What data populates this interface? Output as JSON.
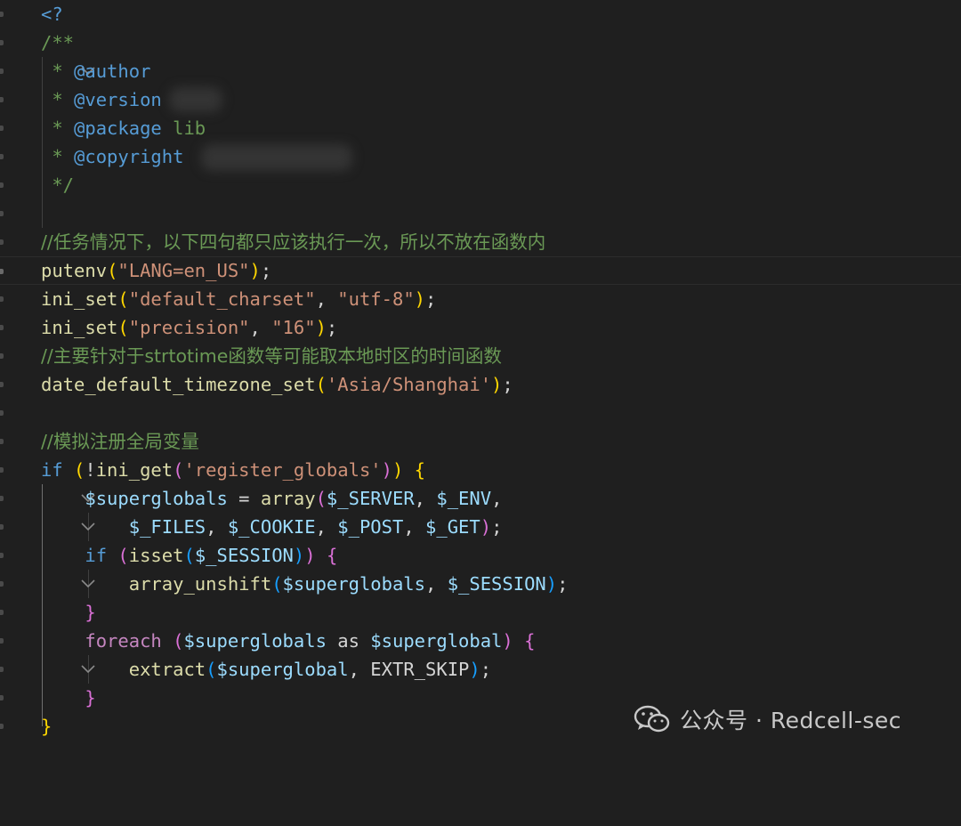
{
  "colors": {
    "background": "#1f1f1f",
    "comment": "#6a9955",
    "string": "#ce9178",
    "function": "#dcdcaa",
    "variable": "#9cdcfe",
    "keyword": "#569cd6",
    "control": "#c586c0",
    "bracket_gold": "#ffd700",
    "bracket_orchid": "#da70d6",
    "bracket_blue": "#179fff"
  },
  "code": {
    "php_open": "<?",
    "doc_open": "/**",
    "author_star": " * ",
    "author_tag": "@author",
    "version_star": " * ",
    "version_tag": "@version",
    "package_star": " * ",
    "package_tag": "@package",
    "package_val": " lib",
    "copyright_star": " * ",
    "copyright_tag": "@copyright",
    "doc_close": " */",
    "comment_1": "//任务情况下，以下四句都只应该执行一次，所以不放在函数内",
    "putenv_fn": "putenv",
    "putenv_arg": "\"LANG=en_US\"",
    "iniset_fn": "ini_set",
    "iniset1_arg1": "\"default_charset\"",
    "iniset1_arg2": "\"utf-8\"",
    "iniset2_arg1": "\"precision\"",
    "iniset2_arg2": "\"16\"",
    "comment_2": "//主要针对于strtotime函数等可能取本地时区的时间函数",
    "tz_fn": "date_default_timezone_set",
    "tz_arg": "'Asia/Shanghai'",
    "comment_3": "//模拟注册全局变量",
    "if_kw": "if",
    "ini_get_fn": "ini_get",
    "register_globals": "'register_globals'",
    "superglobals": "$superglobals",
    "array_fn": "array",
    "server": "$_SERVER",
    "env": "$_ENV",
    "files": "$_FILES",
    "cookie": "$_COOKIE",
    "post": "$_POST",
    "get": "$_GET",
    "isset_fn": "isset",
    "session": "$_SESSION",
    "array_unshift_fn": "array_unshift",
    "foreach_kw": "foreach",
    "as_kw": "as",
    "superglobal": "$superglobal",
    "extract_fn": "extract",
    "extr_skip": "EXTR_SKIP"
  },
  "watermark": {
    "text": "公众号 · Redcell-sec",
    "icon": "wechat-icon"
  }
}
